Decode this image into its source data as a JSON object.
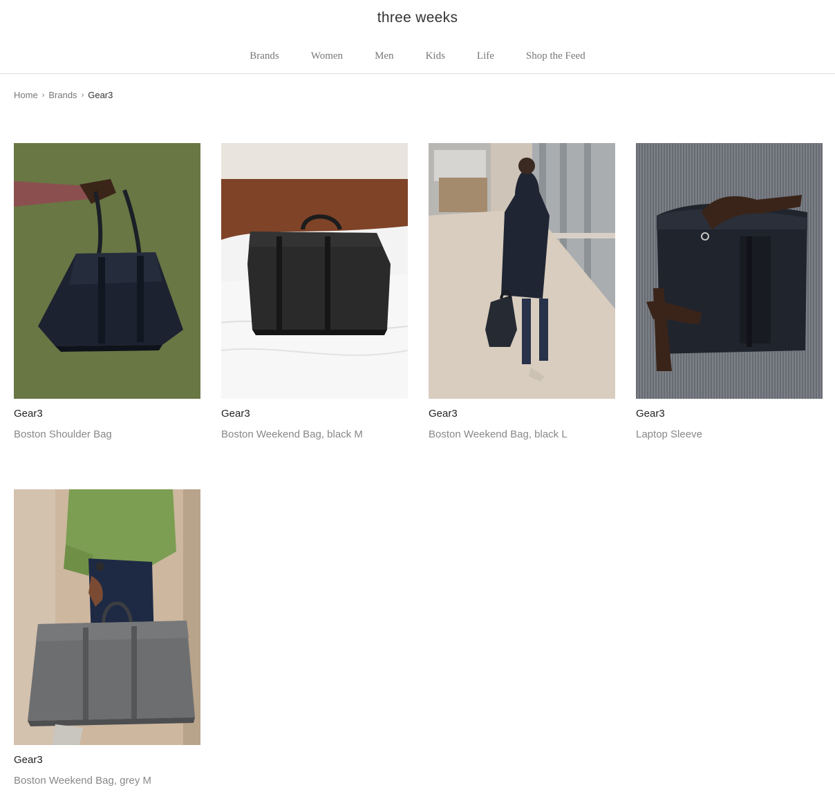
{
  "site": {
    "title": "three weeks"
  },
  "nav": {
    "items": [
      {
        "label": "Brands"
      },
      {
        "label": "Women"
      },
      {
        "label": "Men"
      },
      {
        "label": "Kids"
      },
      {
        "label": "Life"
      },
      {
        "label": "Shop the Feed"
      }
    ]
  },
  "breadcrumb": {
    "home": "Home",
    "brands": "Brands",
    "current": "Gear3"
  },
  "products": [
    {
      "brand": "Gear3",
      "name": "Boston Shoulder Bag",
      "image": "bag-held-green-backdrop-photo"
    },
    {
      "brand": "Gear3",
      "name": "Boston Weekend Bag, black M",
      "image": "bag-on-bed-photo"
    },
    {
      "brand": "Gear3",
      "name": "Boston Weekend Bag, black L",
      "image": "man-walking-street-photo"
    },
    {
      "brand": "Gear3",
      "name": "Laptop Sleeve",
      "image": "laptop-sleeve-held-photo"
    },
    {
      "brand": "Gear3",
      "name": "Boston Weekend Bag, grey M",
      "image": "grey-bag-carried-photo"
    }
  ]
}
